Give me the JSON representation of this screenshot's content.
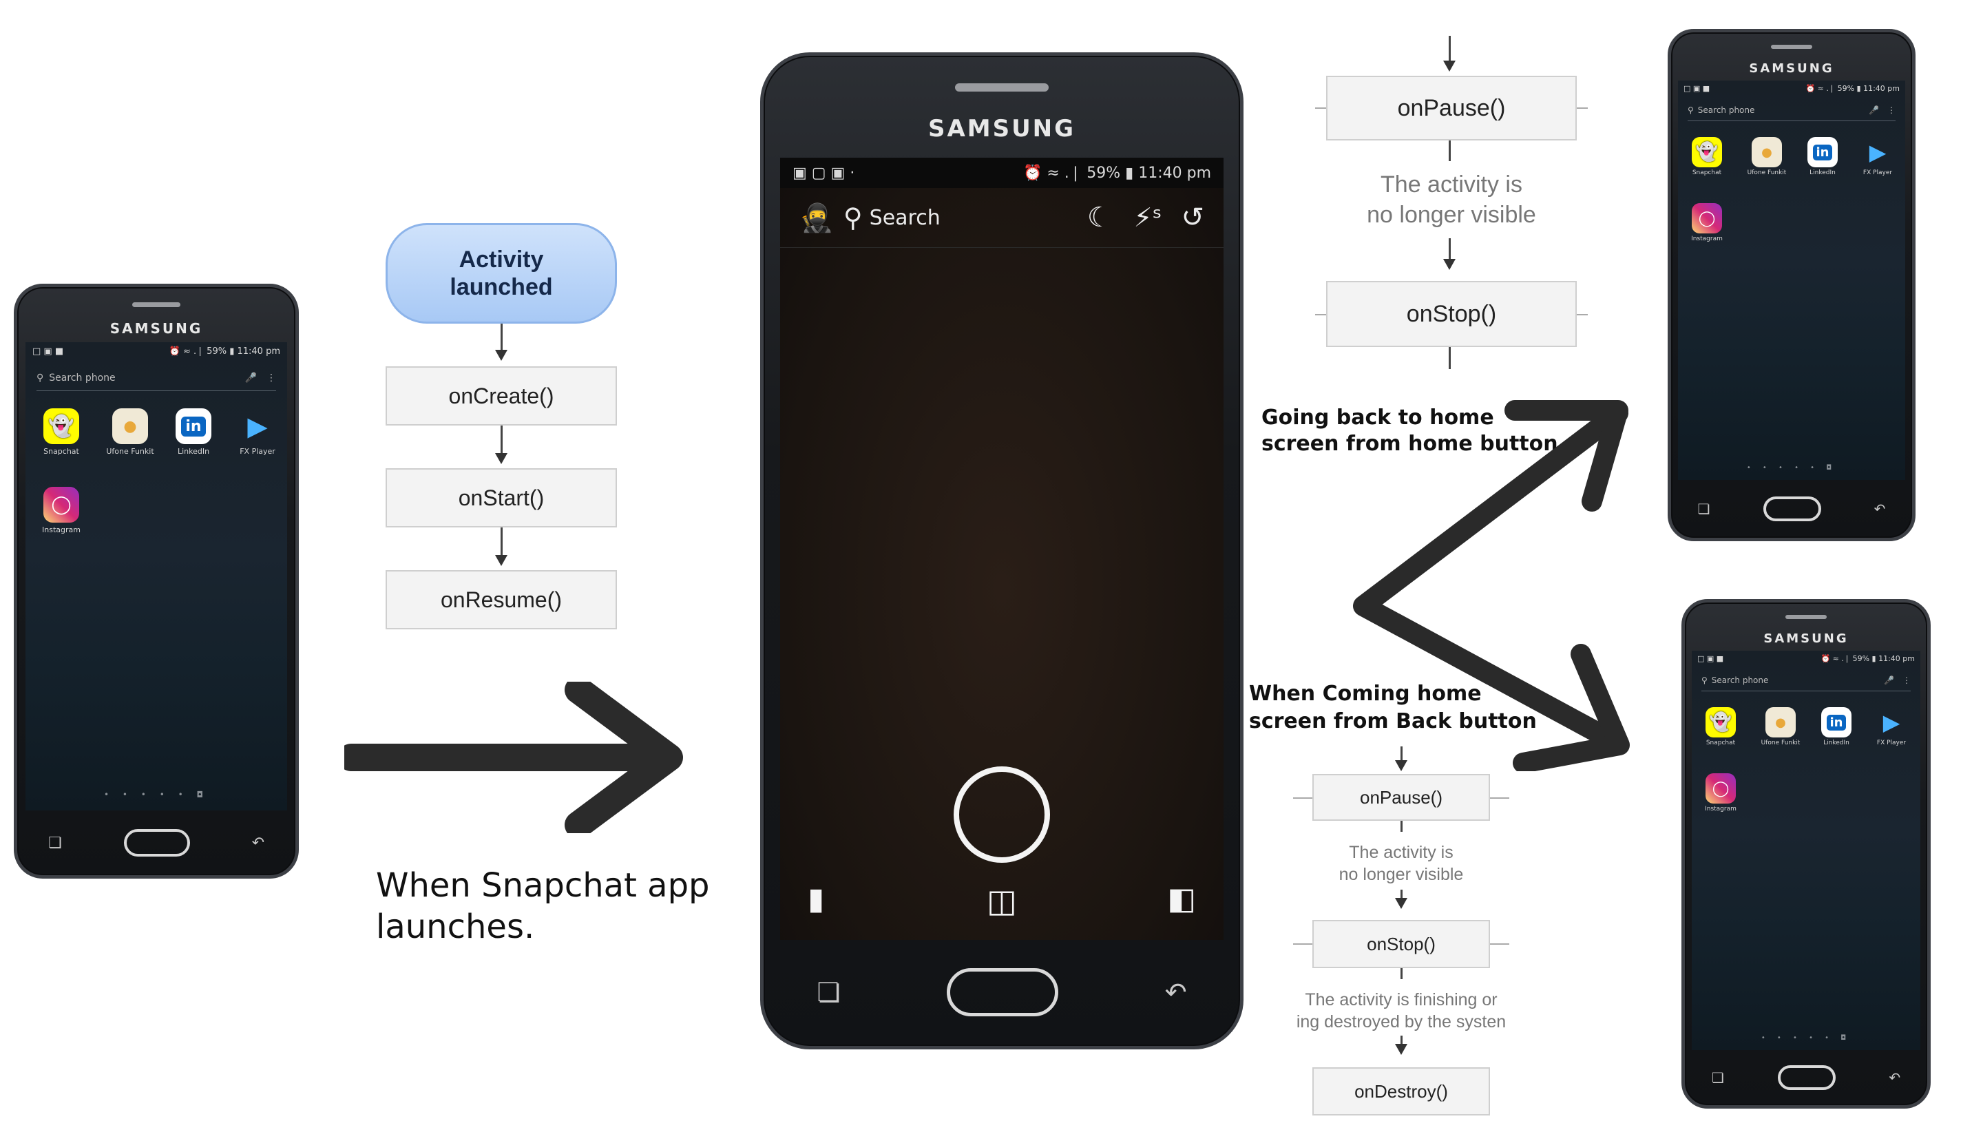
{
  "brand": "SAMSUNG",
  "home_status": {
    "left": "□ ▣ ■",
    "right": "⏰ ≈ .❘ 59% ▮ 11:40 pm"
  },
  "home_search_placeholder": "Search phone",
  "apps": [
    {
      "name": "Snapchat",
      "icon": "snapchat-ghost",
      "color": "#fffc00"
    },
    {
      "name": "Ufone Funkit",
      "icon": "ufone-funkit",
      "color": "#f0e9d6"
    },
    {
      "name": "LinkedIn",
      "icon": "linkedin",
      "color": "#ffffff",
      "glyph": "in"
    },
    {
      "name": "FX Player",
      "icon": "fx-player-play",
      "color": "#1a2530"
    },
    {
      "name": "Instagram",
      "icon": "instagram",
      "color": "#d62976"
    }
  ],
  "snap": {
    "status_right": "⏰ ≈ .❘ 59% ▮ 11:40 pm",
    "search_label": "Search"
  },
  "launch_flow": {
    "start": "Activity launched",
    "steps": [
      "onCreate()",
      "onStart()",
      "onResume()"
    ]
  },
  "caption_launch": [
    "When Snapchat app",
    "launches."
  ],
  "home_flow": {
    "step1": "onPause()",
    "note1": [
      "The activity is",
      "no longer visible"
    ],
    "step2": "onStop()"
  },
  "label_home_button": [
    "Going back to home",
    "screen from home button"
  ],
  "label_back_button": [
    "When Coming home",
    "screen from Back button"
  ],
  "back_flow": {
    "step1": "onPause()",
    "note1": [
      "The activity is",
      "no longer visible"
    ],
    "step2": "onStop()",
    "note2": [
      "The activity is finishing or",
      "ing destroyed by the systen"
    ],
    "step3": "onDestroy()"
  }
}
